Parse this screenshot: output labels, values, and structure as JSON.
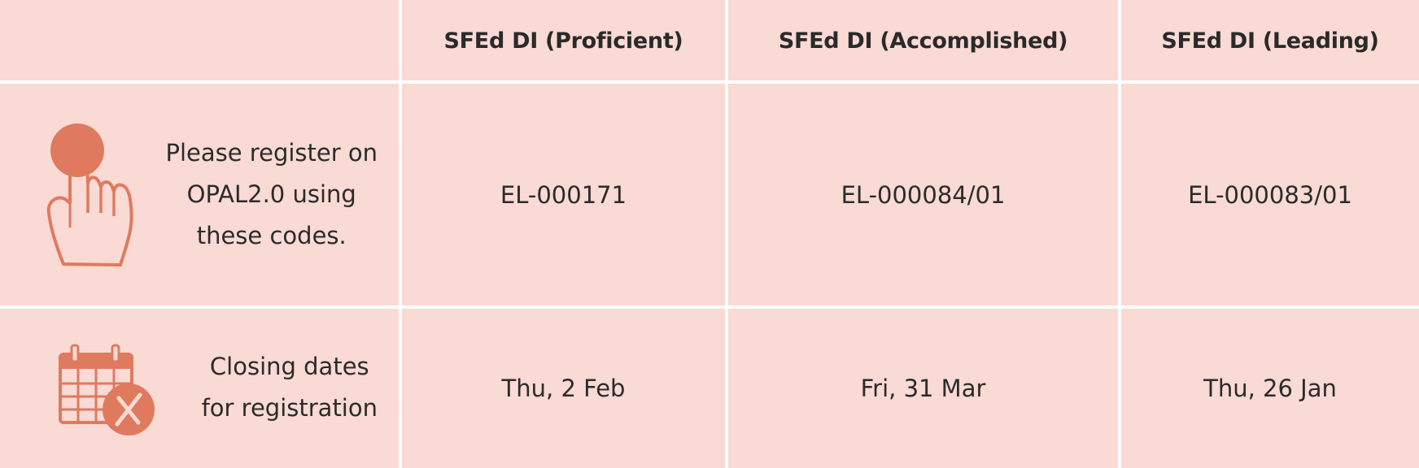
{
  "header": {
    "col1": "SFEd DI (Proficient)",
    "col2": "SFEd DI (Accomplished)",
    "col3": "SFEd DI (Leading)"
  },
  "rows": [
    {
      "icon": "hand-pointer-icon",
      "label_lines": [
        "Please register on",
        "OPAL2.0 using",
        "these codes."
      ],
      "values": [
        "EL-000171",
        "EL-000084/01",
        "EL-000083/01"
      ]
    },
    {
      "icon": "calendar-cancel-icon",
      "label_lines": [
        "Closing dates",
        "for registration"
      ],
      "values": [
        "Thu, 2 Feb",
        "Fri, 31 Mar",
        "Thu, 26 Jan"
      ]
    }
  ],
  "colors": {
    "cell_background": "#f9dad4",
    "divider": "#ffffff",
    "icon": "#e07a5f"
  }
}
